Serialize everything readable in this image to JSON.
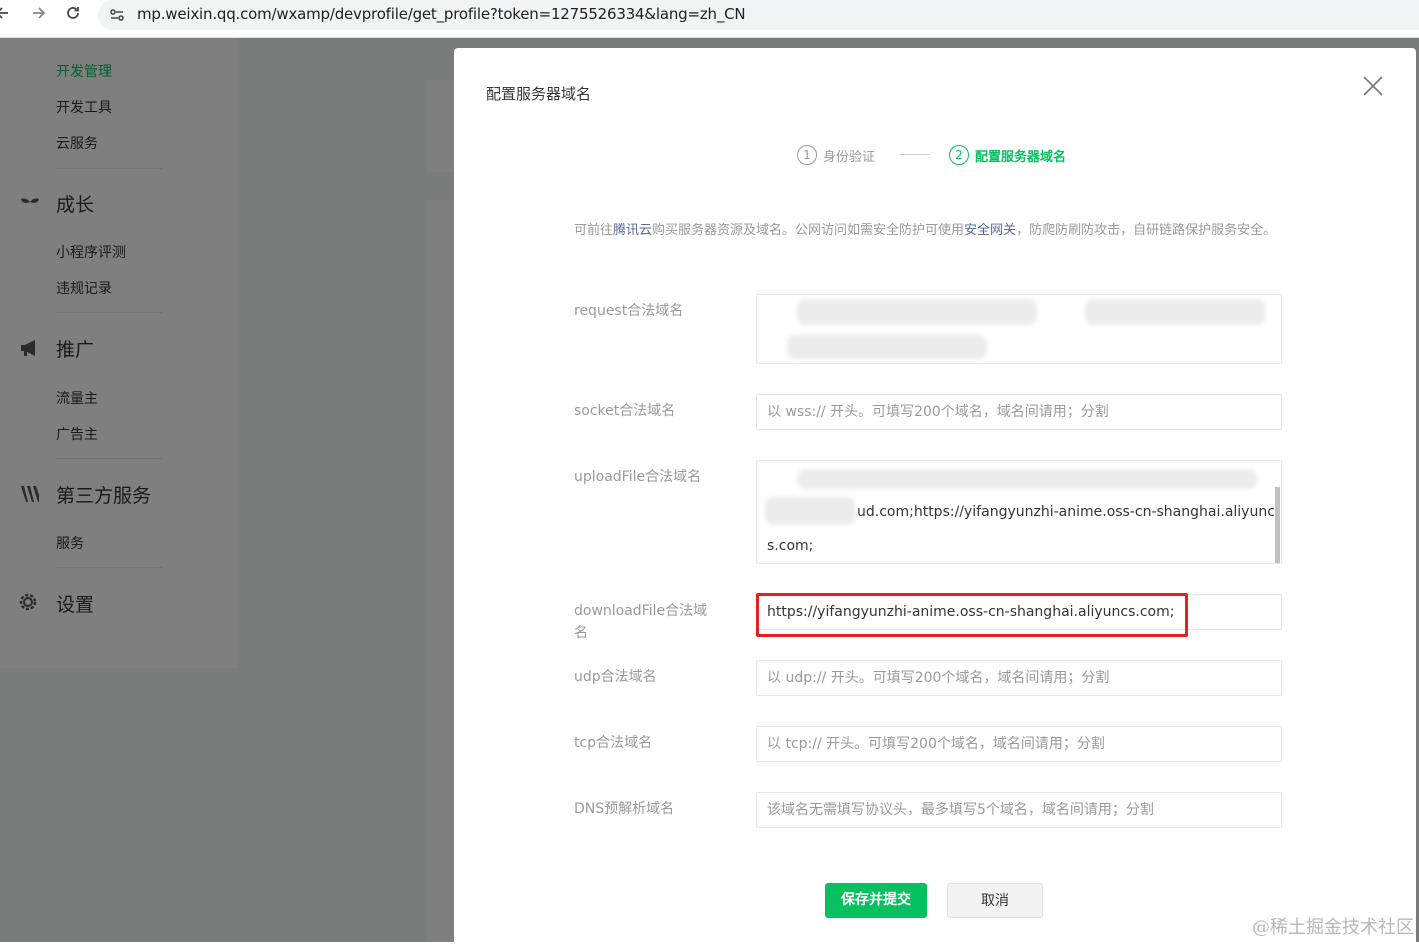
{
  "browser": {
    "url": "mp.weixin.qq.com/wxamp/devprofile/get_profile?token=1275526334&lang=zh_CN"
  },
  "sidebar": {
    "dev_items": [
      {
        "label": "开发管理",
        "active": true
      },
      {
        "label": "开发工具"
      },
      {
        "label": "云服务"
      }
    ],
    "groups": [
      {
        "title": "成长",
        "icon": "leaf-icon",
        "items": [
          "小程序评测",
          "违规记录"
        ]
      },
      {
        "title": "推广",
        "icon": "megaphone-icon",
        "items": [
          "流量主",
          "广告主"
        ]
      },
      {
        "title": "第三方服务",
        "icon": "third-party-icon",
        "items": [
          "服务"
        ]
      },
      {
        "title": "设置",
        "icon": "gear-icon",
        "items": []
      }
    ]
  },
  "dialog": {
    "title": "配置服务器域名",
    "steps": [
      {
        "num": "1",
        "label": "身份验证"
      },
      {
        "num": "2",
        "label": "配置服务器域名"
      }
    ],
    "tip": {
      "prefix": "可前往",
      "link1": "腾讯云",
      "middle": "购买服务器资源及域名。公网访问如需安全防护可使用",
      "link2": "安全网关",
      "suffix": "，防爬防刷防攻击，自研链路保护服务安全。"
    },
    "fields": {
      "request": {
        "label": "request合法域名",
        "value": ""
      },
      "socket": {
        "label": "socket合法域名",
        "placeholder": "以 wss:// 开头。可填写200个域名，域名间请用；分割"
      },
      "uploadFile": {
        "label": "uploadFile合法域名",
        "value_line1": "ud.com;https://yifangyunzhi-anime.oss-cn-shanghai.aliyunc",
        "value_line2": "s.com;"
      },
      "downloadFile": {
        "label": "downloadFile合法域名",
        "value": "https://yifangyunzhi-anime.oss-cn-shanghai.aliyuncs.com;"
      },
      "udp": {
        "label": "udp合法域名",
        "placeholder": "以 udp:// 开头。可填写200个域名，域名间请用；分割"
      },
      "tcp": {
        "label": "tcp合法域名",
        "placeholder": "以 tcp:// 开头。可填写200个域名，域名间请用；分割"
      },
      "dns": {
        "label": "DNS预解析域名",
        "placeholder": "该域名无需填写协议头，最多填写5个域名，域名间请用；分割"
      }
    },
    "buttons": {
      "submit": "保存并提交",
      "cancel": "取消"
    }
  },
  "watermark": "@稀土掘金技术社区",
  "colors": {
    "accent_green": "#07c160",
    "link_blue": "#576b95",
    "highlight_red": "#e0231f"
  }
}
